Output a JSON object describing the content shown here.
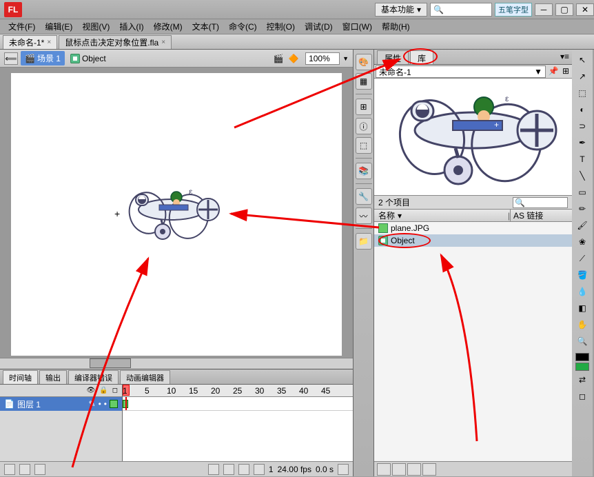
{
  "app": {
    "logo": "FL",
    "workspace": "基本功能",
    "ime": "五笔字型"
  },
  "menus": [
    "文件(F)",
    "编辑(E)",
    "视图(V)",
    "插入(I)",
    "修改(M)",
    "文本(T)",
    "命令(C)",
    "控制(O)",
    "调试(D)",
    "窗口(W)",
    "帮助(H)"
  ],
  "docTabs": [
    {
      "label": "未命名-1*",
      "active": true
    },
    {
      "label": "鼠标点击决定对象位置.fla",
      "active": false
    }
  ],
  "stageHdr": {
    "scene": "场景 1",
    "symbol": "Object",
    "zoom": "100%"
  },
  "timeline": {
    "tabs": [
      "时间轴",
      "输出",
      "编译器错误",
      "动画编辑器"
    ],
    "layer": "图层 1",
    "ticks": [
      1,
      5,
      10,
      15,
      20,
      25,
      30,
      35,
      40,
      45
    ],
    "frame": "1",
    "fps": "24.00 fps",
    "time": "0.0 s"
  },
  "panels": {
    "tabs": [
      "属性",
      "库"
    ],
    "doc": "未命名-1",
    "count": "2 个项目",
    "cols": {
      "name": "名称",
      "link": "AS 链接"
    },
    "items": [
      {
        "label": "plane.JPG",
        "type": "img"
      },
      {
        "label": "Object",
        "type": "mc"
      }
    ]
  },
  "tools": [
    "arrow",
    "subsel",
    "free",
    "3d",
    "lasso",
    "pen",
    "text",
    "line",
    "rect",
    "pencil",
    "brush",
    "deco",
    "bone",
    "bucket",
    "dropper",
    "eraser",
    "hand",
    "zoom"
  ]
}
